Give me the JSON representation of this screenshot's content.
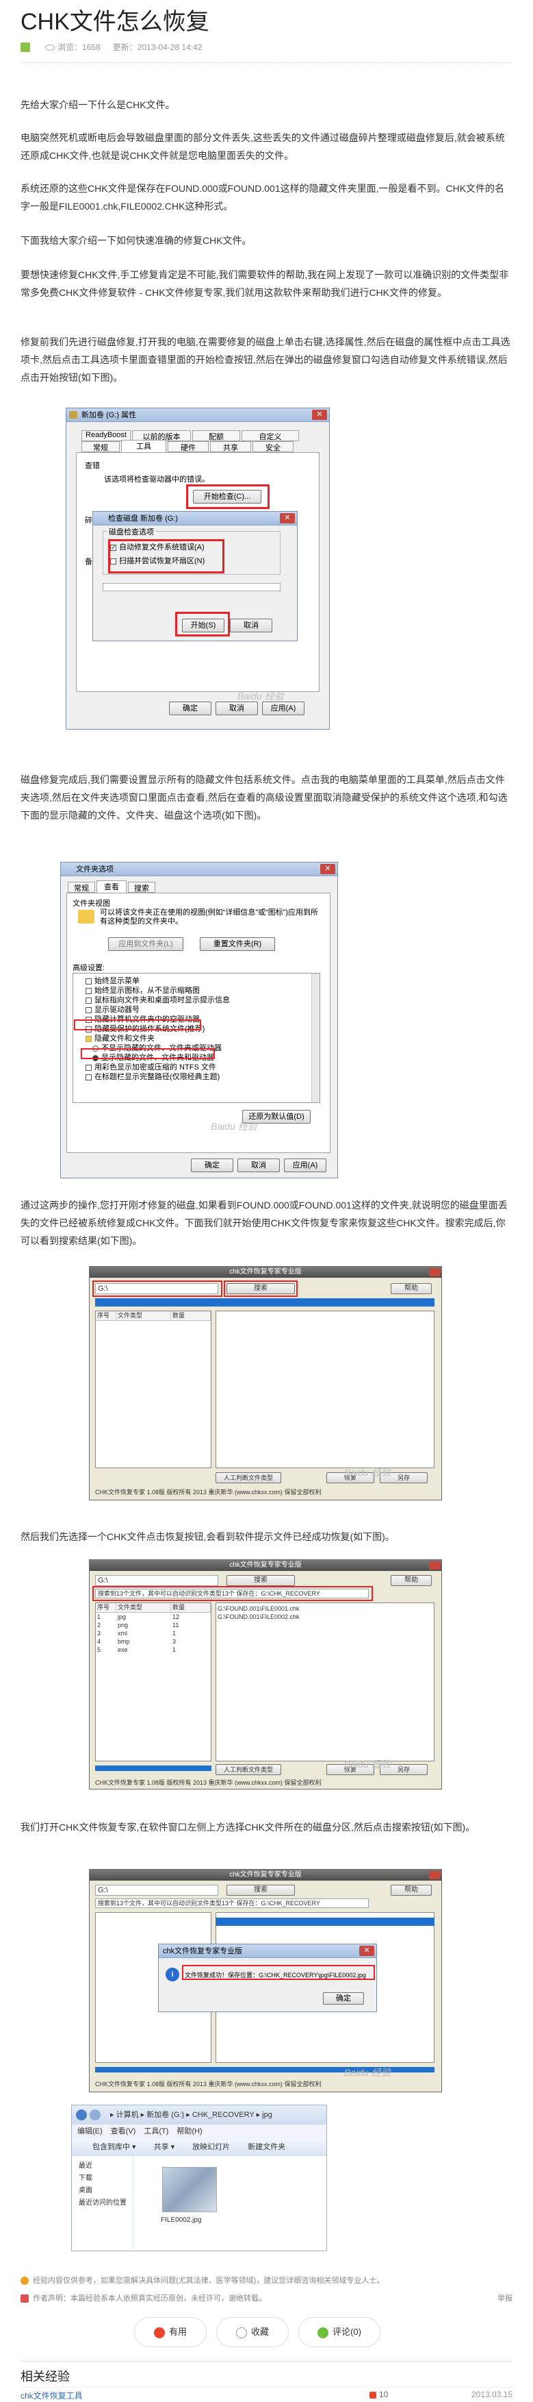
{
  "article": {
    "title": "CHK文件怎么恢复",
    "meta": {
      "views_label": "浏览：1658",
      "updated_label": "更新：2013-04-28 14:42"
    }
  },
  "paragraphs": {
    "p1": "先给大家介绍一下什么是CHK文件。",
    "p2": "电脑突然死机或断电后会导致磁盘里面的部分文件丢失,这些丢失的文件通过磁盘碎片整理或磁盘修复后,就会被系统还原成CHK文件,也就是说CHK文件就是您电脑里面丢失的文件。",
    "p3": "系统还原的这些CHK文件是保存在FOUND.000或FOUND.001这样的隐藏文件夹里面,一般是看不到。CHK文件的名字一般是FILE0001.chk,FILE0002.CHK这种形式。",
    "p4": "下面我给大家介绍一下如何快速准确的修复CHK文件。",
    "p5": "要想快速修复CHK文件,手工修复肯定是不可能,我们需要软件的帮助,我在网上发现了一款可以准确识别的文件类型非常多免费CHK文件修复软件 - CHK文件修复专家,我们就用这款软件来帮助我们进行CHK文件的修复。",
    "p6": "修复前我们先进行磁盘修复,打开我的电脑,在需要修复的磁盘上单击右键,选择属性,然后在磁盘的属性框中点击工具选项卡,然后点击工具选项卡里面查错里面的开始检查按钮,然后在弹出的磁盘修复窗口勾选自动修复文件系统错误,然后点击开始按钮(如下图)。",
    "p7": "磁盘修复完成后,我们需要设置显示所有的隐藏文件包括系统文件。点击我的电脑菜单里面的工具菜单,然后点击文件夹选项,然后在文件夹选项窗口里面点击查看,然后在查看的高级设置里面取消隐藏受保护的系统文件这个选项,和勾选下面的显示隐藏的文件、文件夹、磁盘这个选项(如下图)。",
    "p8": "通过这两步的操作,您打开刚才修复的磁盘,如果看到FOUND.000或FOUND.001这样的文件夹,就说明您的磁盘里面丢失的文件已经被系统修复成CHK文件。下面我们就开始使用CHK文件恢复专家来恢复这些CHK文件。搜索完成后,你可以看到搜索结果(如下图)。",
    "p9": "然后我们先选择一个CHK文件点击恢复按钮,会看到软件提示文件已经成功恢复(如下图)。",
    "p10": "我们打开CHK文件恢复专家,在软件窗口左侧上方选择CHK文件所在的磁盘分区,然后点击搜索按钮(如下图)。"
  },
  "fig1": {
    "window_title": "新加卷 (G:) 属性",
    "tabs_row1": [
      "ReadyBoost",
      "以前的版本",
      "配额",
      "自定义"
    ],
    "tabs_row2": [
      "常规",
      "工具",
      "硬件",
      "共享",
      "安全"
    ],
    "section_check": "查错",
    "check_desc": "该选项将检查驱动器中的错误。",
    "check_button": "开始检查(C)...",
    "section_defrag": "碎片整理",
    "section_backup": "备份",
    "sub_title": "检查磁盘 新加卷 (G:)",
    "sub_group": "磁盘检查选项",
    "opt1": "自动修复文件系统错误(A)",
    "opt2": "扫描并尝试恢复坏扇区(N)",
    "start_button": "开始(S)",
    "cancel_button": "取消",
    "ok_button": "确定",
    "cancel2_button": "取消",
    "apply_button": "应用(A)",
    "watermark": "Baidu 经验"
  },
  "fig2": {
    "window_title": "文件夹选项",
    "tabs": [
      "常规",
      "查看",
      "搜索"
    ],
    "group_views": "文件夹视图",
    "views_desc": "可以将该文件夹正在使用的视图(例如“详细信息”或“图标”)应用到所有这种类型的文件夹中。",
    "apply_folders": "应用到文件夹(L)",
    "reset_folders": "重置文件夹(R)",
    "advanced": "高级设置:",
    "settings": [
      "始终显示菜单",
      "始终显示图标，从不显示缩略图",
      "鼠标指向文件夹和桌面项时显示提示信息",
      "显示驱动器号",
      "隐藏计算机文件夹中的空驱动器",
      "隐藏受保护的操作系统文件(推荐)",
      "隐藏文件和文件夹",
      "不显示隐藏的文件、文件夹或驱动器",
      "显示隐藏的文件、文件夹和驱动器",
      "用彩色显示加密或压缩的 NTFS 文件",
      "在标题栏显示完整路径(仅限经典主题)"
    ],
    "restore_defaults": "还原为默认值(D)",
    "ok": "确定",
    "cancel": "取消",
    "apply": "应用(A)",
    "watermark": "Baidu 经验"
  },
  "fig3": {
    "window_title": "chk文件恢复专家专业版",
    "drive_value": "G:\\",
    "search_button": "搜索",
    "help_button": "帮助",
    "col_id": "序号",
    "col_type": "文件类型",
    "col_count": "数量",
    "manual_button": "人工判断文件类型",
    "restore_button": "恢复",
    "save_button": "另存",
    "footer": "CHK文件恢复专家 1.08版  版权所有 2013 重庆新华 (www.chkxx.com) 保留全部权利",
    "watermark": "Baidu 经验"
  },
  "fig4": {
    "window_title": "chk文件恢复专家专业版",
    "drive_value": "G:\\",
    "search_button": "搜索",
    "help_button": "帮助",
    "status": "搜索到13个文件，其中可以自动识别文件类型13个 保存在：G:\\CHK_RECOVERY",
    "col_id": "序号",
    "col_type": "文件类型",
    "col_count": "数量",
    "rows": [
      {
        "id": "1",
        "type": "jpg",
        "count": "12"
      },
      {
        "id": "2",
        "type": "png",
        "count": "11"
      },
      {
        "id": "3",
        "type": "xml",
        "count": "1"
      },
      {
        "id": "4",
        "type": "bmp",
        "count": "3"
      },
      {
        "id": "5",
        "type": "exe",
        "count": "1"
      }
    ],
    "files": [
      "G:\\FOUND.001\\FILE0001.chk",
      "G:\\FOUND.001\\FILE0002.chk"
    ],
    "manual_button": "人工判断文件类型",
    "restore_button": "恢复",
    "save_button": "另存",
    "footer": "CHK文件恢复专家 1.08版  版权所有 2013 重庆新华 (www.chkxx.com) 保留全部权利",
    "watermark": "Baidu 经验"
  },
  "fig5": {
    "window_title": "chk文件恢复专家专业版",
    "drive_value": "G:\\",
    "search_button": "搜索",
    "help_button": "帮助",
    "status": "搜索到13个文件，其中可以自动识别文件类型13个 保存在：G:\\CHK_RECOVERY",
    "msg_title": "chk文件恢复专家专业版",
    "msg_text": "文件恢复成功！保存位置：G:\\CHK_RECOVERY\\jpg\\FILE0002.jpg",
    "msg_ok": "确定",
    "footer": "CHK文件恢复专家 1.08版  版权所有 2013 重庆新华 (www.chkxx.com) 保留全部权利",
    "watermark": "Baidu 经验"
  },
  "fig6": {
    "path": "▸ 计算机 ▸ 新加卷 (G:) ▸ CHK_RECOVERY ▸ jpg",
    "menus": [
      "编辑(E)",
      "查看(V)",
      "工具(T)",
      "帮助(H)"
    ],
    "toolbar": [
      "包含到库中 ▾",
      "共享 ▾",
      "放映幻灯片",
      "新建文件夹"
    ],
    "nav": [
      "最近",
      "下载",
      "桌面",
      "最近访问的位置"
    ],
    "file_name": "FILE0002.jpg"
  },
  "footer": {
    "notice1": "经验内容仅供参考，如果您需解决具体问题(尤其法律、医学等领域)，建议您详细咨询相关领域专业人士。",
    "notice2": "作者声明：本篇经验系本人依照真实经历原创，未经许可，谢绝转载。",
    "report": "举报",
    "btn_useful": "有用",
    "btn_collect": "收藏",
    "btn_comment": "评论",
    "btn_comment_count": "(0)",
    "related_title": "相关经验",
    "related_item": "chk文件恢复工具",
    "related_votes": "10",
    "related_date": "2013.03.15"
  },
  "colors": {
    "accent_red": "#e8242a",
    "link_blue": "#2a6bb5",
    "badge_green": "#8bc34a"
  }
}
